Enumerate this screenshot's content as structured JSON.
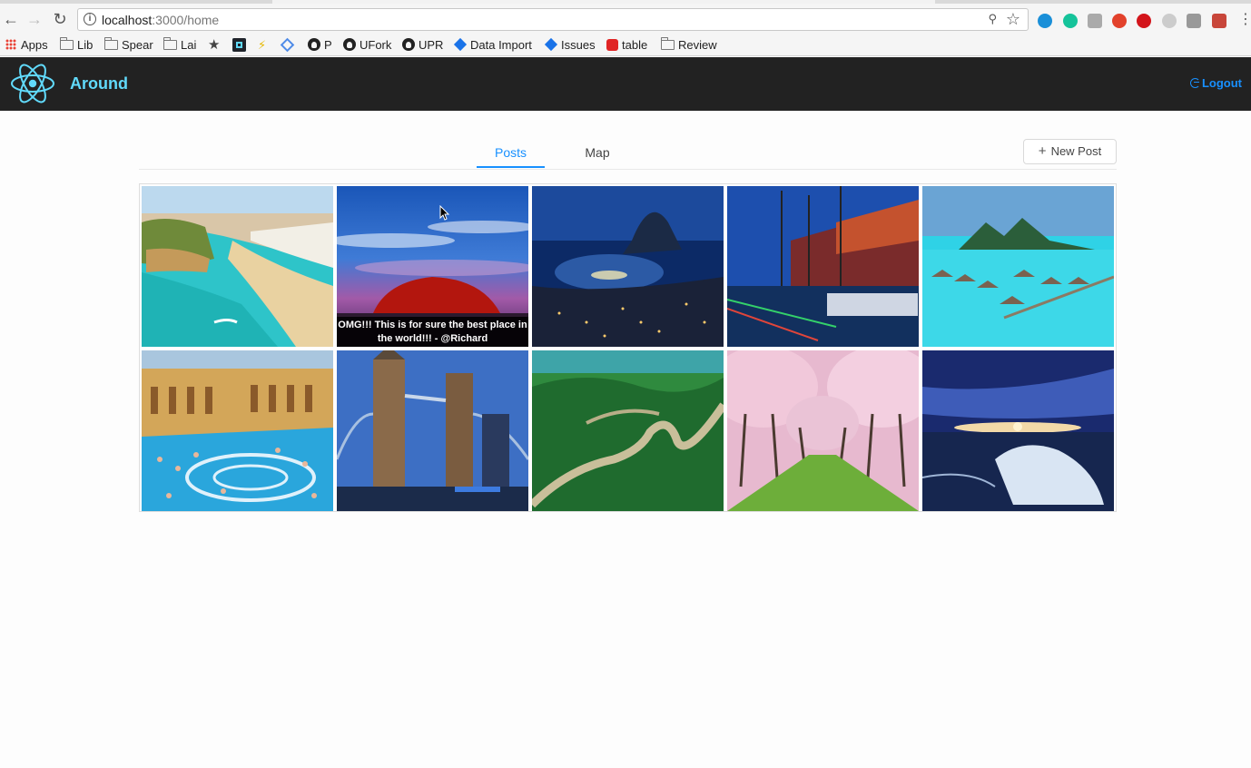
{
  "browser": {
    "url_host": "localhost",
    "url_path": ":3000/home",
    "bookmarks": [
      {
        "label": "Apps",
        "type": "apps"
      },
      {
        "label": "Lib",
        "type": "folder"
      },
      {
        "label": "Spear",
        "type": "folder"
      },
      {
        "label": "Lai",
        "type": "folder"
      },
      {
        "label": "",
        "type": "star"
      },
      {
        "label": "",
        "type": "react"
      },
      {
        "label": "",
        "type": "bolt"
      },
      {
        "label": "",
        "type": "gem"
      },
      {
        "label": "P",
        "type": "github"
      },
      {
        "label": "UFork",
        "type": "github"
      },
      {
        "label": "UPR",
        "type": "github"
      },
      {
        "label": "Data Import",
        "type": "jira"
      },
      {
        "label": "Issues",
        "type": "jira"
      },
      {
        "label": "table",
        "type": "stack"
      },
      {
        "label": "Review",
        "type": "folder"
      }
    ],
    "extensions": [
      {
        "name": "ring-extension-icon",
        "color": "#1a8fd8"
      },
      {
        "name": "grammarly-icon",
        "color": "#15c39a"
      },
      {
        "name": "g-extension-icon",
        "color": "#aaaaaa"
      },
      {
        "name": "shield-extension-icon",
        "color": "#e2412b"
      },
      {
        "name": "adblock-icon",
        "color": "#d3151b"
      },
      {
        "name": "snowflake-extension-icon",
        "color": "#cccccc"
      },
      {
        "name": "json-extension-icon",
        "color": "#999999"
      },
      {
        "name": "puzzle-extension-icon",
        "color": "#c8463a"
      }
    ]
  },
  "app": {
    "title": "Around",
    "logout_label": "Logout",
    "brand_color": "#61dafb",
    "accent_color": "#1890ff"
  },
  "tabs": [
    {
      "label": "Posts",
      "active": true
    },
    {
      "label": "Map",
      "active": false
    }
  ],
  "new_post_label": "New Post",
  "gallery": {
    "images": [
      {
        "name": "beach-cliff-photo"
      },
      {
        "name": "uluru-sunset-photo",
        "caption": "OMG!!! This is for sure the best place in the world!!! - @Richard"
      },
      {
        "name": "rio-night-photo"
      },
      {
        "name": "harbor-night-photo"
      },
      {
        "name": "bora-bora-photo"
      },
      {
        "name": "thermal-bath-photo"
      },
      {
        "name": "tower-bridge-photo"
      },
      {
        "name": "great-wall-photo"
      },
      {
        "name": "cherry-blossom-photo"
      },
      {
        "name": "ice-sunset-photo"
      }
    ]
  }
}
